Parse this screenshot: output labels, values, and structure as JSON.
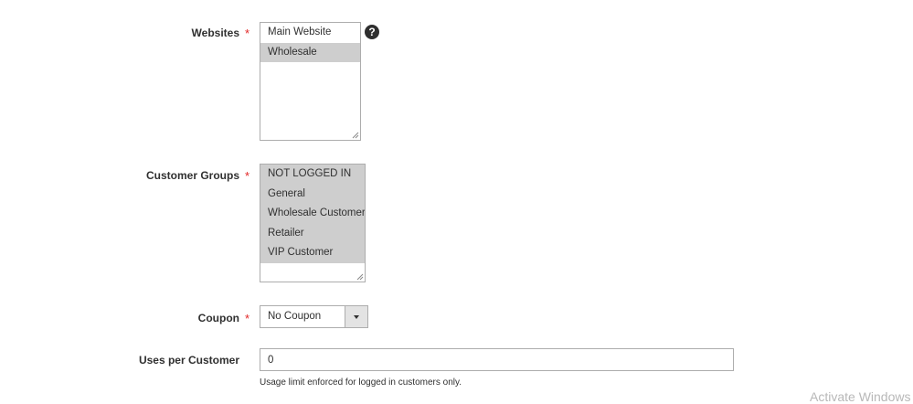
{
  "websites": {
    "label": "Websites",
    "required_mark": "*",
    "options": [
      {
        "label": "Main Website",
        "selected": false
      },
      {
        "label": "Wholesale",
        "selected": true
      }
    ],
    "help_icon": "question-circle-icon"
  },
  "customer_groups": {
    "label": "Customer Groups",
    "required_mark": "*",
    "options": [
      {
        "label": "NOT LOGGED IN",
        "selected": true
      },
      {
        "label": "General",
        "selected": true
      },
      {
        "label": "Wholesale Customer",
        "selected": true
      },
      {
        "label": "Retailer",
        "selected": true
      },
      {
        "label": "VIP Customer",
        "selected": true
      }
    ]
  },
  "coupon": {
    "label": "Coupon",
    "required_mark": "*",
    "selected_value": "No Coupon",
    "arrow_icon": "caret-down-icon"
  },
  "uses_per_customer": {
    "label": "Uses per Customer",
    "value": "0",
    "note": "Usage limit enforced for logged in customers only."
  },
  "watermark": "Activate Windows",
  "colors": {
    "required_star": "#e22626",
    "selected_option_bg": "#cecece",
    "border": "#adadad"
  }
}
